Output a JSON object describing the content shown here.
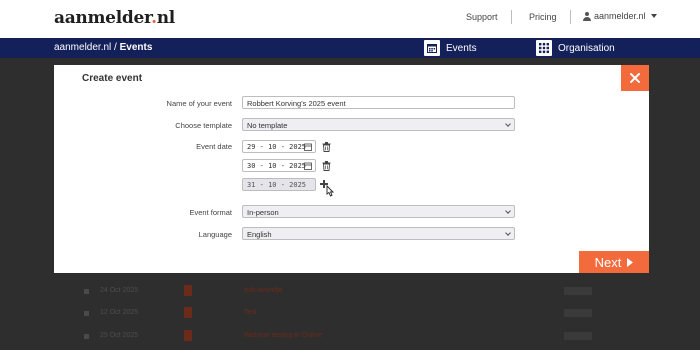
{
  "header": {
    "logo_main": "aanmelder",
    "logo_dot": ".",
    "logo_tld": "nl",
    "support": "Support",
    "pricing": "Pricing",
    "user": "aanmelder.nl"
  },
  "navbar": {
    "breadcrumb_root": "aanmelder.nl",
    "breadcrumb_sep": " / ",
    "breadcrumb_current": "Events",
    "events": "Events",
    "organisation": "Organisation"
  },
  "background_rows": [
    {
      "date": "24 Oct 2025",
      "name": "Info-avondje"
    },
    {
      "date": "12 Oct 2025",
      "name": "Test"
    },
    {
      "date": "29 Oct 2025",
      "name": "Webinar testing in Online"
    }
  ],
  "modal": {
    "title": "Create event",
    "name_label": "Name of your event",
    "name_value": "Robbert Korving's 2025 event",
    "template_label": "Choose template",
    "template_value": "No template",
    "date_label": "Event date",
    "dates": [
      {
        "value": "29 - 10 - 2025"
      },
      {
        "value": "30 - 10 - 2025"
      },
      {
        "value": "31 - 10 - 2025"
      }
    ],
    "format_label": "Event format",
    "format_value": "In-person",
    "language_label": "Language",
    "language_value": "English",
    "next_label": "Next"
  },
  "colors": {
    "accent": "#f36a3c",
    "navy": "#13205a"
  }
}
